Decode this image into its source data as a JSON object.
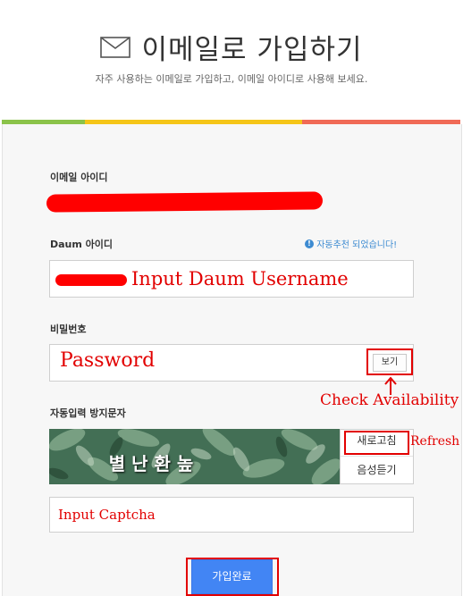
{
  "header": {
    "title": "이메일로 가입하기",
    "subtitle": "자주 사용하는 이메일로 가입하고, 이메일 아이디로 사용해 보세요."
  },
  "colors": {
    "bar_green": "#8bc34a",
    "bar_yellow": "#f5c518",
    "bar_red": "#f06a56",
    "accent_blue": "#4285f4",
    "annotation_red": "#e20000",
    "recommend_blue": "#3d8bd1"
  },
  "form": {
    "email_label": "이메일 아이디",
    "daum_label": "Daum 아이디",
    "recommend_notice": "자동추천 되었습니다!",
    "password_label": "비밀번호",
    "view_button": "보기",
    "captcha_label": "자동입력 방지문자",
    "captcha_text": "별난환높",
    "refresh_button": "새로고침",
    "audio_button": "음성듣기",
    "submit_button": "가입완료"
  },
  "annotations": {
    "username": "Input Daum Username",
    "password": "Password",
    "check": "Check Availability",
    "refresh": "Refresh",
    "captcha": "Input Captcha"
  }
}
